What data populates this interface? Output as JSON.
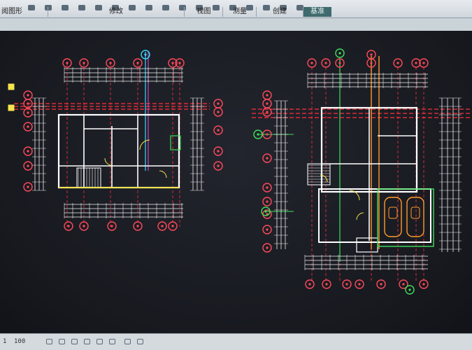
{
  "ribbon": {
    "panels": [
      {
        "label": "阅图形",
        "active": false
      },
      {
        "label": "修改",
        "active": false
      },
      {
        "label": "视图",
        "active": false
      },
      {
        "label": "测量",
        "active": false
      },
      {
        "label": "创建",
        "active": false
      },
      {
        "label": "基准",
        "active": true
      }
    ]
  },
  "statusbar": {
    "detail_level": "1",
    "scale": "100"
  },
  "colors": {
    "background": "#1a1d24",
    "wall": "#ffffff",
    "grid_line": "#ff2f3a",
    "grid_bubble": "#ff4a5a",
    "dimension": "#f2f2f2",
    "door": "#f5e44a",
    "garage_car": "#ff9a2a",
    "selected_grid": "#3de05a",
    "cyan_grid": "#38d8ff"
  },
  "drawings": [
    {
      "name": "floor-plan-left"
    },
    {
      "name": "floor-plan-right"
    }
  ]
}
